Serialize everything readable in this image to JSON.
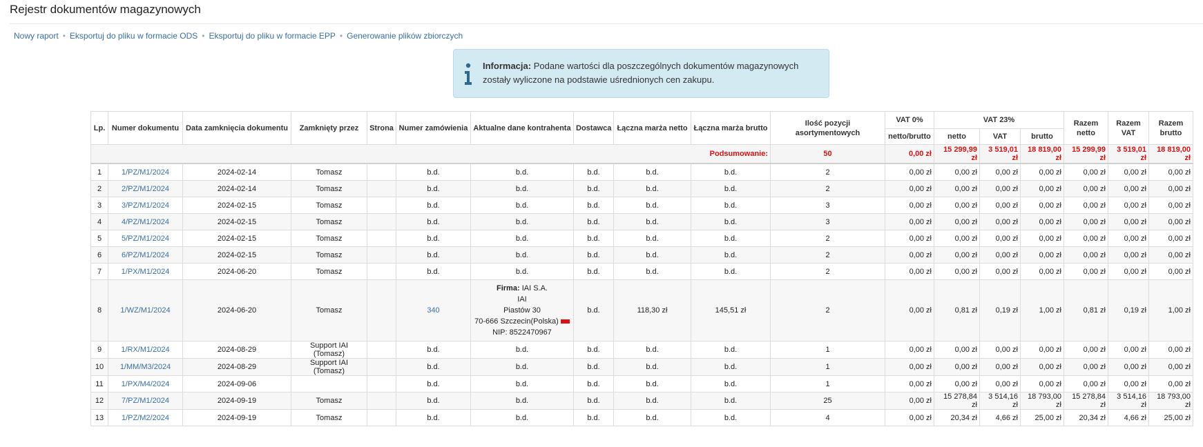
{
  "page": {
    "title": "Rejestr dokumentów magazynowych"
  },
  "actions": [
    "Nowy raport",
    "Eksportuj do pliku w formacie ODS",
    "Eksportuj do pliku w formacie EPP",
    "Generowanie plików zbiorczych"
  ],
  "info": {
    "icon": "info-icon",
    "label": "Informacja:",
    "text": "Podane wartości dla poszczególnych dokumentów magazynowych zostały wyliczone na podstawie uśrednionych cen zakupu."
  },
  "table": {
    "headers": {
      "lp": "Lp.",
      "doc": "Numer dokumentu",
      "date": "Data zamknięcia dokumentu",
      "closed_by": "Zamknięty przez",
      "page": "Strona",
      "order": "Numer zamówienia",
      "contractor": "Aktualne dane kontrahenta",
      "supplier": "Dostawca",
      "margin_net": "Łączna marża netto",
      "margin_gross": "Łączna marża brutto",
      "items": "Ilość pozycji asortymentowych",
      "vat0": "VAT 0%",
      "vat0_sub": "netto/brutto",
      "vat23": "VAT 23%",
      "vat23_net": "netto",
      "vat23_vat": "VAT",
      "vat23_gross": "brutto",
      "total_net": "Razem netto",
      "total_vat": "Razem VAT",
      "total_gross": "Razem brutto"
    },
    "summary": {
      "label": "Podsumowanie:",
      "items": "50",
      "vat0": "0,00 zł",
      "vat23_net": "15 299,99 zł",
      "vat23_vat": "3 519,01 zł",
      "vat23_gross": "18 819,00 zł",
      "total_net": "15 299,99 zł",
      "total_vat": "3 519,01 zł",
      "total_gross": "18 819,00 zł"
    },
    "contractor_8": {
      "firma_label": "Firma:",
      "firma": "IAI S.A.",
      "line2": "IAI",
      "line3": "Piastów 30",
      "line4": "70-666 Szczecin(Polska)",
      "nip": "NIP: 8522470967"
    },
    "rows": [
      {
        "lp": "1",
        "doc": "1/PZ/M1/2024",
        "date": "2024-02-14",
        "by": "Tomasz",
        "page": "",
        "order": "b.d.",
        "contr": "b.d.",
        "sup": "b.d.",
        "mn": "b.d.",
        "mg": "b.d.",
        "items": "2",
        "v0": "0,00 zł",
        "n": "0,00 zł",
        "v": "0,00 zł",
        "b": "0,00 zł",
        "tn": "0,00 zł",
        "tv": "0,00 zł",
        "tb": "0,00 zł"
      },
      {
        "lp": "2",
        "doc": "2/PZ/M1/2024",
        "date": "2024-02-14",
        "by": "Tomasz",
        "page": "",
        "order": "b.d.",
        "contr": "b.d.",
        "sup": "b.d.",
        "mn": "b.d.",
        "mg": "b.d.",
        "items": "2",
        "v0": "0,00 zł",
        "n": "0,00 zł",
        "v": "0,00 zł",
        "b": "0,00 zł",
        "tn": "0,00 zł",
        "tv": "0,00 zł",
        "tb": "0,00 zł"
      },
      {
        "lp": "3",
        "doc": "3/PZ/M1/2024",
        "date": "2024-02-15",
        "by": "Tomasz",
        "page": "",
        "order": "b.d.",
        "contr": "b.d.",
        "sup": "b.d.",
        "mn": "b.d.",
        "mg": "b.d.",
        "items": "3",
        "v0": "0,00 zł",
        "n": "0,00 zł",
        "v": "0,00 zł",
        "b": "0,00 zł",
        "tn": "0,00 zł",
        "tv": "0,00 zł",
        "tb": "0,00 zł"
      },
      {
        "lp": "4",
        "doc": "4/PZ/M1/2024",
        "date": "2024-02-15",
        "by": "Tomasz",
        "page": "",
        "order": "b.d.",
        "contr": "b.d.",
        "sup": "b.d.",
        "mn": "b.d.",
        "mg": "b.d.",
        "items": "3",
        "v0": "0,00 zł",
        "n": "0,00 zł",
        "v": "0,00 zł",
        "b": "0,00 zł",
        "tn": "0,00 zł",
        "tv": "0,00 zł",
        "tb": "0,00 zł"
      },
      {
        "lp": "5",
        "doc": "5/PZ/M1/2024",
        "date": "2024-02-15",
        "by": "Tomasz",
        "page": "",
        "order": "b.d.",
        "contr": "b.d.",
        "sup": "b.d.",
        "mn": "b.d.",
        "mg": "b.d.",
        "items": "2",
        "v0": "0,00 zł",
        "n": "0,00 zł",
        "v": "0,00 zł",
        "b": "0,00 zł",
        "tn": "0,00 zł",
        "tv": "0,00 zł",
        "tb": "0,00 zł"
      },
      {
        "lp": "6",
        "doc": "6/PZ/M1/2024",
        "date": "2024-02-15",
        "by": "Tomasz",
        "page": "",
        "order": "b.d.",
        "contr": "b.d.",
        "sup": "b.d.",
        "mn": "b.d.",
        "mg": "b.d.",
        "items": "2",
        "v0": "0,00 zł",
        "n": "0,00 zł",
        "v": "0,00 zł",
        "b": "0,00 zł",
        "tn": "0,00 zł",
        "tv": "0,00 zł",
        "tb": "0,00 zł"
      },
      {
        "lp": "7",
        "doc": "1/PX/M1/2024",
        "date": "2024-06-20",
        "by": "Tomasz",
        "page": "",
        "order": "b.d.",
        "contr": "b.d.",
        "sup": "b.d.",
        "mn": "b.d.",
        "mg": "b.d.",
        "items": "2",
        "v0": "0,00 zł",
        "n": "0,00 zł",
        "v": "0,00 zł",
        "b": "0,00 zł",
        "tn": "0,00 zł",
        "tv": "0,00 zł",
        "tb": "0,00 zł"
      },
      {
        "lp": "8",
        "doc": "1/WZ/M1/2024",
        "date": "2024-06-20",
        "by": "Tomasz",
        "page": "",
        "order": "340",
        "contr": "",
        "sup": "b.d.",
        "mn": "118,30 zł",
        "mg": "145,51 zł",
        "items": "2",
        "v0": "0,00 zł",
        "n": "0,81 zł",
        "v": "0,19 zł",
        "b": "1,00 zł",
        "tn": "0,81 zł",
        "tv": "0,19 zł",
        "tb": "1,00 zł"
      },
      {
        "lp": "9",
        "doc": "1/RX/M1/2024",
        "date": "2024-08-29",
        "by": "Support IAI (Tomasz)",
        "page": "",
        "order": "b.d.",
        "contr": "b.d.",
        "sup": "b.d.",
        "mn": "b.d.",
        "mg": "b.d.",
        "items": "1",
        "v0": "0,00 zł",
        "n": "0,00 zł",
        "v": "0,00 zł",
        "b": "0,00 zł",
        "tn": "0,00 zł",
        "tv": "0,00 zł",
        "tb": "0,00 zł"
      },
      {
        "lp": "10",
        "doc": "1/MM/M3/2024",
        "date": "2024-08-29",
        "by": "Support IAI (Tomasz)",
        "page": "",
        "order": "b.d.",
        "contr": "b.d.",
        "sup": "b.d.",
        "mn": "b.d.",
        "mg": "b.d.",
        "items": "1",
        "v0": "0,00 zł",
        "n": "0,00 zł",
        "v": "0,00 zł",
        "b": "0,00 zł",
        "tn": "0,00 zł",
        "tv": "0,00 zł",
        "tb": "0,00 zł"
      },
      {
        "lp": "11",
        "doc": "1/PX/M4/2024",
        "date": "2024-09-06",
        "by": "",
        "page": "",
        "order": "b.d.",
        "contr": "b.d.",
        "sup": "b.d.",
        "mn": "b.d.",
        "mg": "b.d.",
        "items": "1",
        "v0": "0,00 zł",
        "n": "0,00 zł",
        "v": "0,00 zł",
        "b": "0,00 zł",
        "tn": "0,00 zł",
        "tv": "0,00 zł",
        "tb": "0,00 zł"
      },
      {
        "lp": "12",
        "doc": "7/PZ/M1/2024",
        "date": "2024-09-19",
        "by": "Tomasz",
        "page": "",
        "order": "b.d.",
        "contr": "b.d.",
        "sup": "b.d.",
        "mn": "b.d.",
        "mg": "b.d.",
        "items": "25",
        "v0": "0,00 zł",
        "n": "15 278,84 zł",
        "v": "3 514,16 zł",
        "b": "18 793,00 zł",
        "tn": "15 278,84 zł",
        "tv": "3 514,16 zł",
        "tb": "18 793,00 zł"
      },
      {
        "lp": "13",
        "doc": "1/PZ/M2/2024",
        "date": "2024-09-19",
        "by": "Tomasz",
        "page": "",
        "order": "b.d.",
        "contr": "b.d.",
        "sup": "b.d.",
        "mn": "b.d.",
        "mg": "b.d.",
        "items": "4",
        "v0": "0,00 zł",
        "n": "20,34 zł",
        "v": "4,66 zł",
        "b": "25,00 zł",
        "tn": "20,34 zł",
        "tv": "4,66 zł",
        "tb": "25,00 zł"
      }
    ]
  }
}
